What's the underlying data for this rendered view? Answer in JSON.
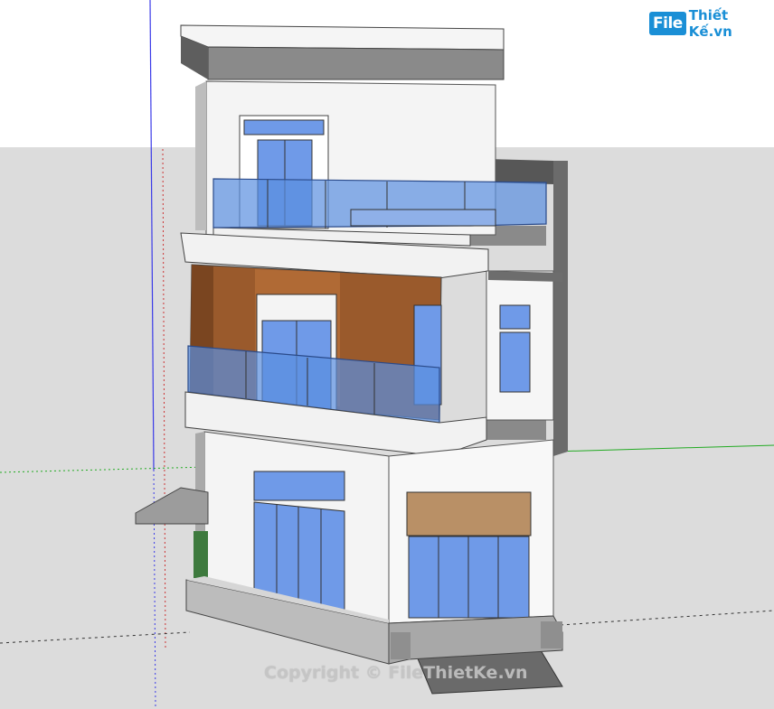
{
  "logo": {
    "mark": "File",
    "rest": "Thiết Kế.vn"
  },
  "watermark": {
    "copyright": "Copyright © FileThietKe.vn"
  },
  "colors": {
    "sky": "#ffffff",
    "ground": "#dcdcdc",
    "wall": "#f4f4f4",
    "glass": "#5a8fe0",
    "wood": "#9a5a2c",
    "brick": "#6b6b6b",
    "roof": "#7d7d7d",
    "axis_green": "#22aa22",
    "axis_blue": "#3333ee",
    "axis_red": "#cc3333"
  }
}
